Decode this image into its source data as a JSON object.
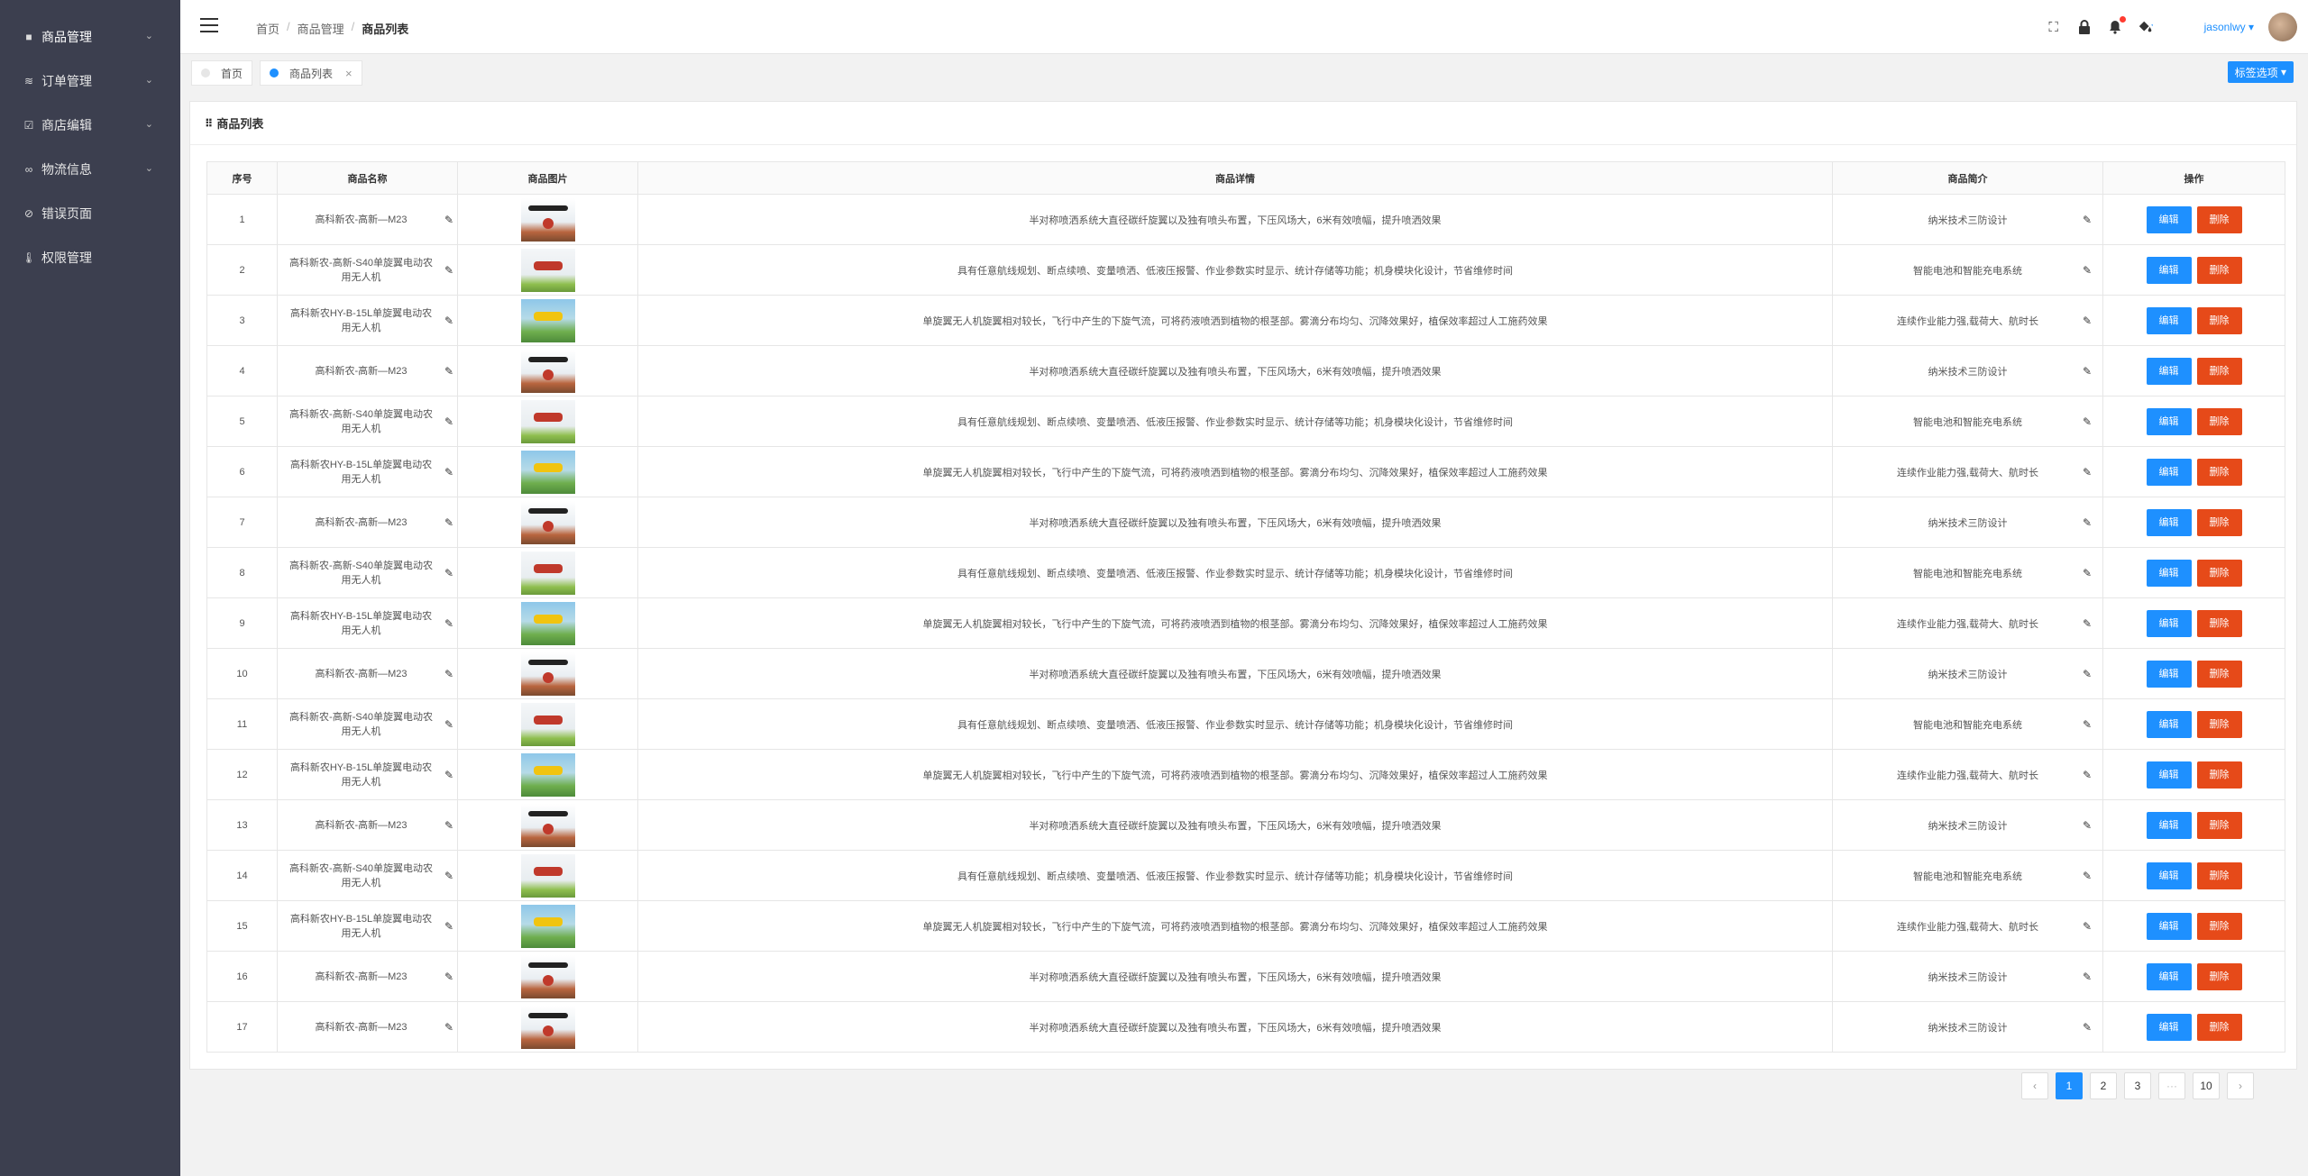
{
  "sidebar": {
    "items": [
      {
        "label": "商品管理",
        "icon": "square-icon",
        "glyph": "■"
      },
      {
        "label": "订单管理",
        "icon": "layers-icon",
        "glyph": "≋"
      },
      {
        "label": "商店编辑",
        "icon": "checkbox-icon",
        "glyph": "☑"
      },
      {
        "label": "物流信息",
        "icon": "infinity-icon",
        "glyph": "∞"
      },
      {
        "label": "错误页面",
        "icon": "warning-circle-icon",
        "glyph": "⊘"
      },
      {
        "label": "权限管理",
        "icon": "thermometer-icon",
        "glyph": "🌡"
      }
    ]
  },
  "header": {
    "breadcrumb": {
      "home": "首页",
      "parent": "商品管理",
      "current": "商品列表"
    },
    "user": "jasonlwy"
  },
  "tabs": {
    "home": "首页",
    "current": "商品列表",
    "close": "×",
    "options": "标签选项"
  },
  "panel": {
    "title": "商品列表"
  },
  "table": {
    "headers": {
      "index": "序号",
      "name": "商品名称",
      "image": "商品图片",
      "detail": "商品详情",
      "intro": "商品简介",
      "actions": "操作"
    },
    "edit_label": "编辑",
    "delete_label": "删除",
    "rows": [
      {
        "index": "1",
        "name": "高科新农-高新—M23",
        "img": "t1",
        "detail": "半对称喷洒系统大直径碳纤旋翼以及独有喷头布置，下压风场大，6米有效喷幅，提升喷洒效果",
        "intro": "纳米技术三防设计"
      },
      {
        "index": "2",
        "name": "高科新农-高新-S40单旋翼电动农用无人机",
        "img": "t2",
        "detail": "具有任意航线规划、断点续喷、变量喷洒、低液压报警、作业参数实时显示、统计存储等功能；机身模块化设计，节省维修时间",
        "intro": "智能电池和智能充电系统"
      },
      {
        "index": "3",
        "name": "高科新农HY-B-15L单旋翼电动农用无人机",
        "img": "t3",
        "detail": "单旋翼无人机旋翼相对较长，飞行中产生的下旋气流，可将药液喷洒到植物的根茎部。雾滴分布均匀、沉降效果好，植保效率超过人工施药效果",
        "intro": "连续作业能力强,载荷大、航时长"
      },
      {
        "index": "4",
        "name": "高科新农-高新—M23",
        "img": "t1",
        "detail": "半对称喷洒系统大直径碳纤旋翼以及独有喷头布置，下压风场大，6米有效喷幅，提升喷洒效果",
        "intro": "纳米技术三防设计"
      },
      {
        "index": "5",
        "name": "高科新农-高新-S40单旋翼电动农用无人机",
        "img": "t2",
        "detail": "具有任意航线规划、断点续喷、变量喷洒、低液压报警、作业参数实时显示、统计存储等功能；机身模块化设计，节省维修时间",
        "intro": "智能电池和智能充电系统"
      },
      {
        "index": "6",
        "name": "高科新农HY-B-15L单旋翼电动农用无人机",
        "img": "t3",
        "detail": "单旋翼无人机旋翼相对较长，飞行中产生的下旋气流，可将药液喷洒到植物的根茎部。雾滴分布均匀、沉降效果好，植保效率超过人工施药效果",
        "intro": "连续作业能力强,载荷大、航时长"
      },
      {
        "index": "7",
        "name": "高科新农-高新—M23",
        "img": "t1",
        "detail": "半对称喷洒系统大直径碳纤旋翼以及独有喷头布置，下压风场大，6米有效喷幅，提升喷洒效果",
        "intro": "纳米技术三防设计"
      },
      {
        "index": "8",
        "name": "高科新农-高新-S40单旋翼电动农用无人机",
        "img": "t2",
        "detail": "具有任意航线规划、断点续喷、变量喷洒、低液压报警、作业参数实时显示、统计存储等功能；机身模块化设计，节省维修时间",
        "intro": "智能电池和智能充电系统"
      },
      {
        "index": "9",
        "name": "高科新农HY-B-15L单旋翼电动农用无人机",
        "img": "t3",
        "detail": "单旋翼无人机旋翼相对较长，飞行中产生的下旋气流，可将药液喷洒到植物的根茎部。雾滴分布均匀、沉降效果好，植保效率超过人工施药效果",
        "intro": "连续作业能力强,载荷大、航时长"
      },
      {
        "index": "10",
        "name": "高科新农-高新—M23",
        "img": "t1",
        "detail": "半对称喷洒系统大直径碳纤旋翼以及独有喷头布置，下压风场大，6米有效喷幅，提升喷洒效果",
        "intro": "纳米技术三防设计"
      },
      {
        "index": "11",
        "name": "高科新农-高新-S40单旋翼电动农用无人机",
        "img": "t2",
        "detail": "具有任意航线规划、断点续喷、变量喷洒、低液压报警、作业参数实时显示、统计存储等功能；机身模块化设计，节省维修时间",
        "intro": "智能电池和智能充电系统"
      },
      {
        "index": "12",
        "name": "高科新农HY-B-15L单旋翼电动农用无人机",
        "img": "t3",
        "detail": "单旋翼无人机旋翼相对较长，飞行中产生的下旋气流，可将药液喷洒到植物的根茎部。雾滴分布均匀、沉降效果好，植保效率超过人工施药效果",
        "intro": "连续作业能力强,载荷大、航时长"
      },
      {
        "index": "13",
        "name": "高科新农-高新—M23",
        "img": "t1",
        "detail": "半对称喷洒系统大直径碳纤旋翼以及独有喷头布置，下压风场大，6米有效喷幅，提升喷洒效果",
        "intro": "纳米技术三防设计"
      },
      {
        "index": "14",
        "name": "高科新农-高新-S40单旋翼电动农用无人机",
        "img": "t2",
        "detail": "具有任意航线规划、断点续喷、变量喷洒、低液压报警、作业参数实时显示、统计存储等功能；机身模块化设计，节省维修时间",
        "intro": "智能电池和智能充电系统"
      },
      {
        "index": "15",
        "name": "高科新农HY-B-15L单旋翼电动农用无人机",
        "img": "t3",
        "detail": "单旋翼无人机旋翼相对较长，飞行中产生的下旋气流，可将药液喷洒到植物的根茎部。雾滴分布均匀、沉降效果好，植保效率超过人工施药效果",
        "intro": "连续作业能力强,载荷大、航时长"
      },
      {
        "index": "16",
        "name": "高科新农-高新—M23",
        "img": "t1",
        "detail": "半对称喷洒系统大直径碳纤旋翼以及独有喷头布置，下压风场大，6米有效喷幅，提升喷洒效果",
        "intro": "纳米技术三防设计"
      },
      {
        "index": "17",
        "name": "高科新农-高新—M23",
        "img": "t1",
        "detail": "半对称喷洒系统大直径碳纤旋翼以及独有喷头布置，下压风场大，6米有效喷幅，提升喷洒效果",
        "intro": "纳米技术三防设计"
      }
    ]
  },
  "pagination": {
    "prev": "‹",
    "pages": [
      "1",
      "2",
      "3"
    ],
    "ellipsis": "···",
    "last": "10",
    "next": "›",
    "current": "1"
  },
  "colors": {
    "sidebar_bg": "#3c3f4f",
    "primary": "#1e90ff",
    "danger": "#e64a19"
  }
}
